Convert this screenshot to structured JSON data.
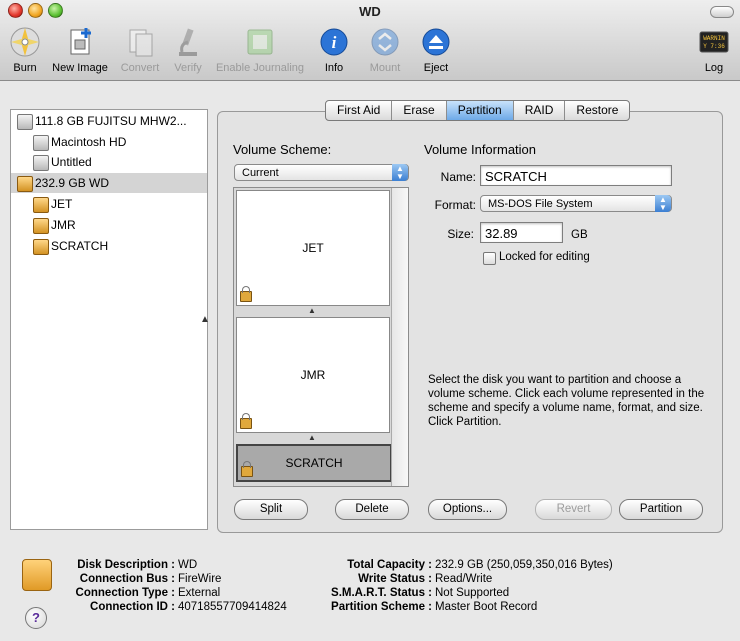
{
  "window": {
    "title": "WD"
  },
  "toolbar": {
    "burn": "Burn",
    "new_image": "New Image",
    "convert": "Convert",
    "verify": "Verify",
    "enable_journaling": "Enable Journaling",
    "info": "Info",
    "mount": "Mount",
    "eject": "Eject",
    "log": "Log",
    "log_icon_text": "WARNIN\nY 7:36"
  },
  "disks": [
    {
      "label": "111.8 GB FUJITSU MHW2...",
      "kind": "disk",
      "selected": false
    },
    {
      "label": "Macintosh HD",
      "kind": "volume",
      "selected": false
    },
    {
      "label": "Untitled",
      "kind": "volume",
      "selected": false
    },
    {
      "label": "232.9 GB WD",
      "kind": "disk",
      "selected": true
    },
    {
      "label": "JET",
      "kind": "volume",
      "selected": false
    },
    {
      "label": "JMR",
      "kind": "volume",
      "selected": false
    },
    {
      "label": "SCRATCH",
      "kind": "volume",
      "selected": false
    }
  ],
  "tabs": [
    "First Aid",
    "Erase",
    "Partition",
    "RAID",
    "Restore"
  ],
  "active_tab": "Partition",
  "partition": {
    "volume_scheme_label": "Volume Scheme:",
    "volume_scheme_value": "Current",
    "volumes": [
      "JET",
      "JMR",
      "SCRATCH"
    ],
    "selected_volume": "SCRATCH",
    "volume_info_title": "Volume Information",
    "name_label": "Name:",
    "name_value": "SCRATCH",
    "format_label": "Format:",
    "format_value": "MS-DOS File System",
    "size_label": "Size:",
    "size_value": "32.89",
    "size_unit": "GB",
    "locked_label": "Locked for editing",
    "locked_checked": false,
    "help_text": "Select the disk you want to partition and choose a volume scheme. Click each volume represented in the scheme and specify a volume name, format, and size. Click Partition.",
    "buttons": {
      "split": "Split",
      "delete": "Delete",
      "options": "Options...",
      "revert": "Revert",
      "partition": "Partition"
    }
  },
  "info": {
    "disk_description_label": "Disk Description :",
    "disk_description": "WD",
    "connection_bus_label": "Connection Bus :",
    "connection_bus": "FireWire",
    "connection_type_label": "Connection Type :",
    "connection_type": "External",
    "connection_id_label": "Connection ID :",
    "connection_id": "4071855770941482​4",
    "total_capacity_label": "Total Capacity :",
    "total_capacity": "232.9 GB (250,059,350,016 Bytes)",
    "write_status_label": "Write Status :",
    "write_status": "Read/Write",
    "smart_status_label": "S.M.A.R.T. Status :",
    "smart_status": "Not Supported",
    "partition_scheme_label": "Partition Scheme :",
    "partition_scheme": "Master Boot Record"
  },
  "help_button": "?"
}
